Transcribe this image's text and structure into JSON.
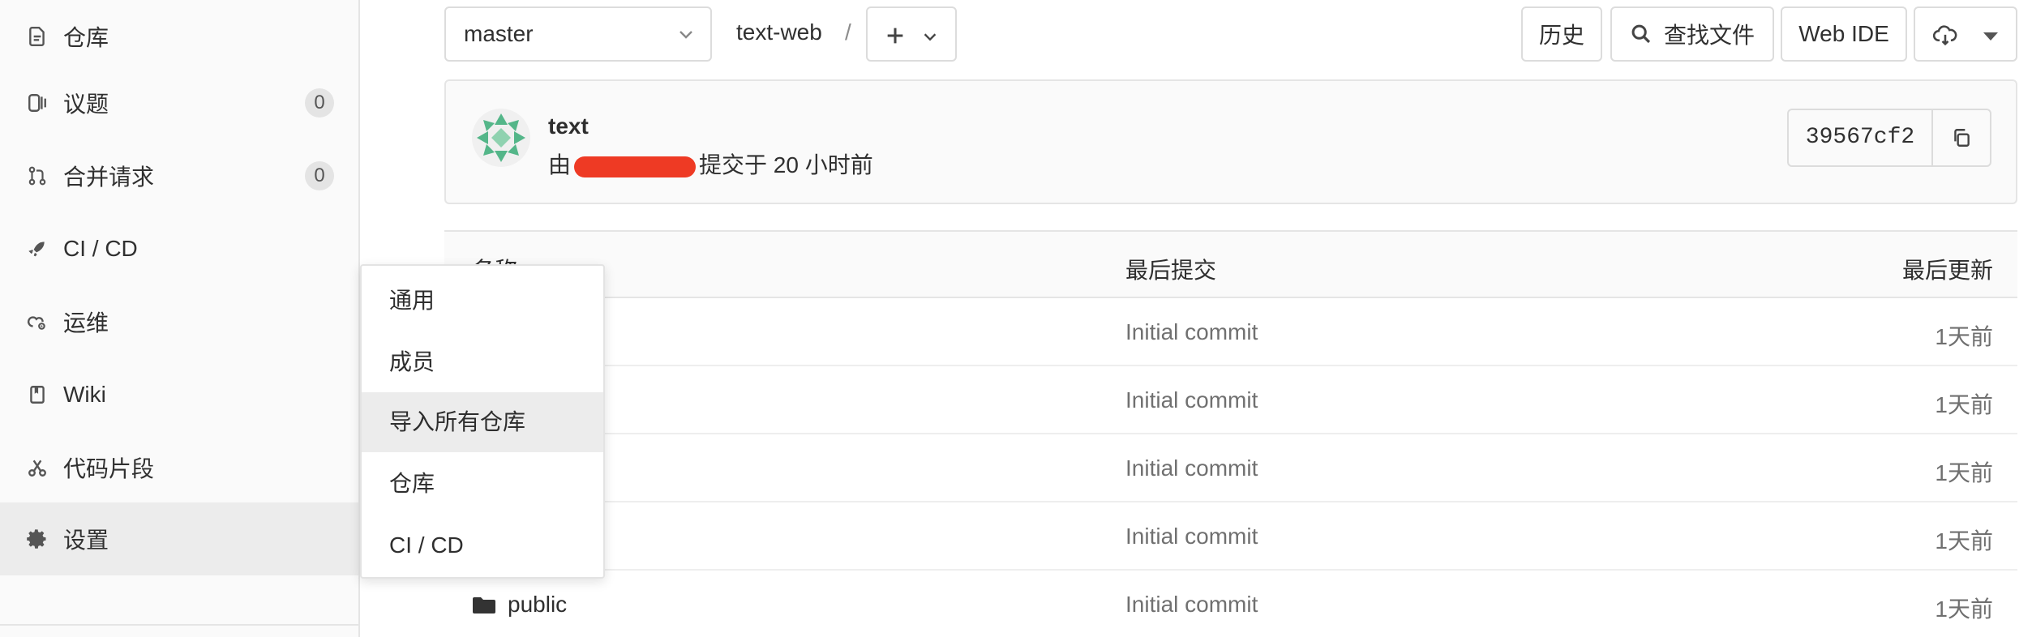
{
  "sidebar": {
    "items": [
      {
        "label": "仓库",
        "icon": "doc-icon"
      },
      {
        "label": "议题",
        "icon": "issues-icon",
        "badge": "0"
      },
      {
        "label": "合并请求",
        "icon": "merge-request-icon",
        "badge": "0"
      },
      {
        "label": "CI / CD",
        "icon": "rocket-icon"
      },
      {
        "label": "运维",
        "icon": "cloud-gear-icon"
      },
      {
        "label": "Wiki",
        "icon": "book-icon"
      },
      {
        "label": "代码片段",
        "icon": "scissors-icon"
      },
      {
        "label": "设置",
        "icon": "gear-icon",
        "active": true
      }
    ]
  },
  "toolbar": {
    "branch": "master",
    "path_root": "text-web",
    "path_separator": "/",
    "history_label": "历史",
    "find_file_label": "查找文件",
    "web_ide_label": "Web IDE"
  },
  "commit": {
    "title": "text",
    "meta_prefix": "由",
    "meta_suffix": "提交于 20 小时前",
    "sha": "39567cf2"
  },
  "table": {
    "headers": {
      "name": "名称",
      "last_commit": "最后提交",
      "last_update": "最后更新"
    },
    "rows": [
      {
        "name": "",
        "commit": "Initial commit",
        "updated": "1天前"
      },
      {
        "name": "",
        "commit": "Initial commit",
        "updated": "1天前"
      },
      {
        "name": "",
        "commit": "Initial commit",
        "updated": "1天前"
      },
      {
        "name": "",
        "commit": "Initial commit",
        "updated": "1天前"
      },
      {
        "name": "public",
        "commit": "Initial commit",
        "updated": "1天前",
        "icon": "folder-icon"
      }
    ]
  },
  "settings_menu": {
    "items": [
      "通用",
      "成员",
      "导入所有仓库",
      "仓库",
      "CI / CD"
    ],
    "hovered": "导入所有仓库"
  },
  "colors": {
    "redaction": "#ee3a24",
    "avatar_green": "#54b689"
  }
}
